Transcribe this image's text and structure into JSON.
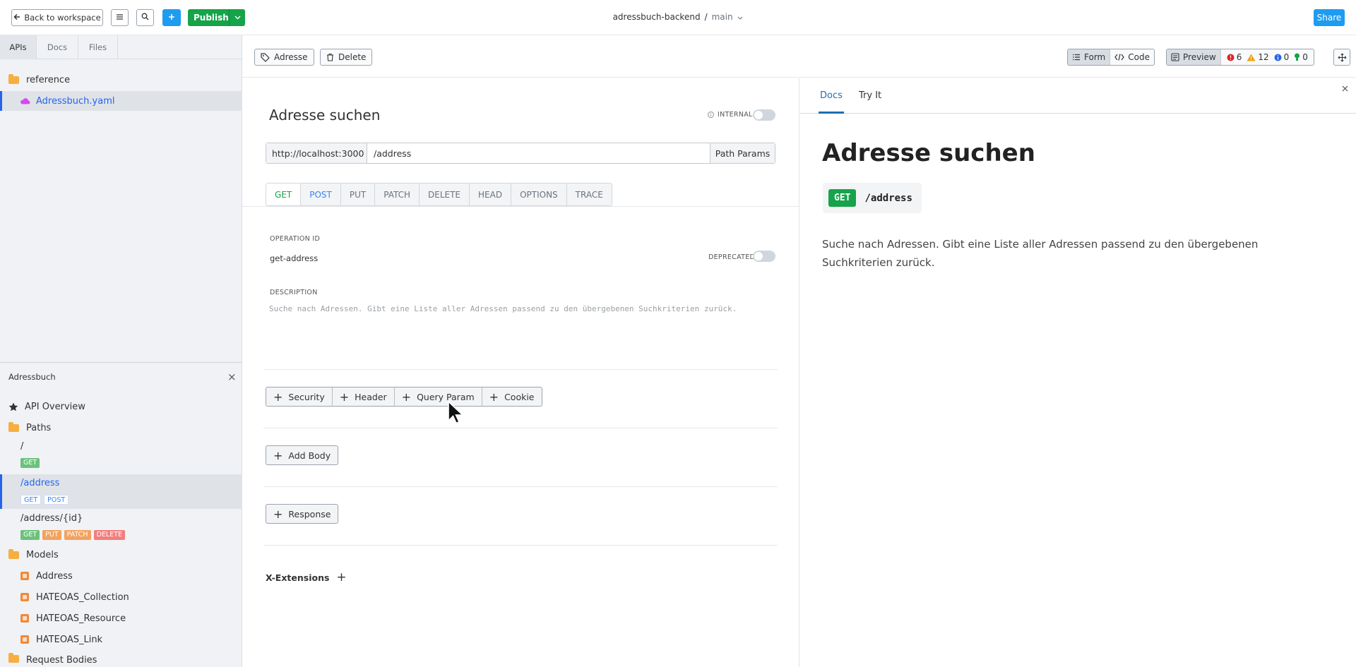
{
  "topbar": {
    "back_label": "Back to workspace",
    "publish_label": "Publish",
    "project": "adressbuch-backend",
    "separator": "/",
    "branch": "main",
    "share_label": "Share"
  },
  "sidebar": {
    "tabs": [
      {
        "label": "APIs"
      },
      {
        "label": "Docs"
      },
      {
        "label": "Files"
      }
    ],
    "tree": {
      "folder": "reference",
      "file": "Adressbuch.yaml"
    },
    "panel": {
      "title": "Adressbuch",
      "close": "×",
      "overview": "API Overview",
      "paths_label": "Paths",
      "paths": [
        {
          "path": "/",
          "methods": [
            "GET"
          ]
        },
        {
          "path": "/address",
          "methods": [
            "GET",
            "POST"
          ]
        },
        {
          "path": "/address/{id}",
          "methods": [
            "GET",
            "PUT",
            "PATCH",
            "DELETE"
          ]
        }
      ],
      "models_label": "Models",
      "models": [
        "Address",
        "HATEOAS_Collection",
        "HATEOAS_Resource",
        "HATEOAS_Link"
      ],
      "request_bodies_label": "Request Bodies"
    }
  },
  "toolbar": {
    "tag_label": "Adresse",
    "delete_label": "Delete",
    "form_label": "Form",
    "code_label": "Code",
    "preview_label": "Preview",
    "errors": "6",
    "warnings": "12",
    "infos": "0",
    "hints": "0"
  },
  "form": {
    "title": "Adresse suchen",
    "internal_label": "INTERNAL",
    "host": "http://localhost:3000",
    "path": "/address",
    "path_params_label": "Path Params",
    "methods": [
      "GET",
      "POST",
      "PUT",
      "PATCH",
      "DELETE",
      "HEAD",
      "OPTIONS",
      "TRACE"
    ],
    "operation_id_label": "OPERATION ID",
    "operation_id": "get-address",
    "deprecated_label": "DEPRECATED",
    "description_label": "DESCRIPTION",
    "description": "Suche nach Adressen. Gibt eine Liste aller Adressen passend zu den übergebenen Suchkriterien zurück.",
    "param_buttons": [
      "Security",
      "Header",
      "Query Param",
      "Cookie"
    ],
    "add_body_label": "Add Body",
    "response_label": "Response",
    "x_extensions_label": "X-Extensions"
  },
  "preview": {
    "tabs": [
      "Docs",
      "Try It"
    ],
    "title": "Adresse suchen",
    "method": "GET",
    "path": "/address",
    "description": "Suche nach Adressen. Gibt eine Liste aller Adressen passend zu den übergebenen Suchkriterien zurück."
  },
  "colors": {
    "accent_blue": "#1e9cf0",
    "publish_green": "#16a34a",
    "selection_blue": "#2563eb"
  }
}
